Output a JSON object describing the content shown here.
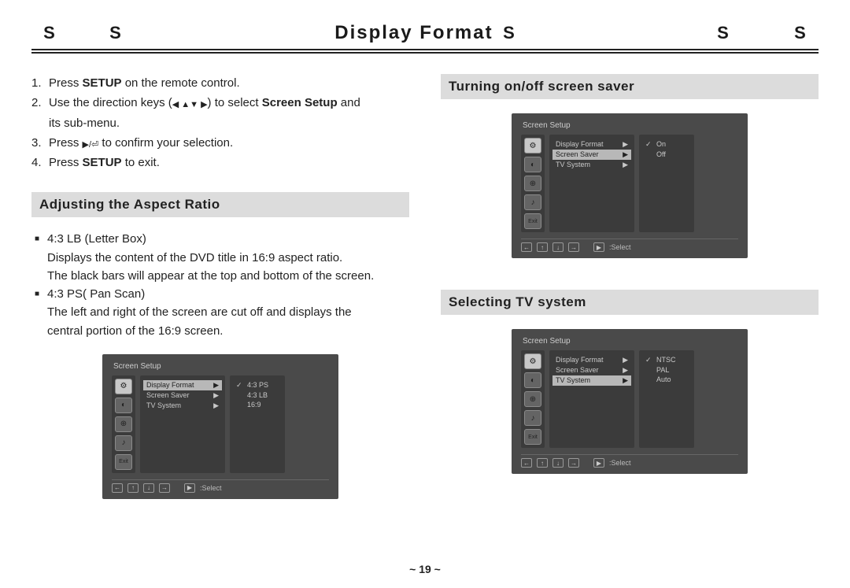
{
  "header": {
    "decor_s": "S",
    "title": "Display Format"
  },
  "intro": {
    "step1_a": "1.",
    "step1_b": "Press ",
    "step1_bold": "SETUP",
    "step1_c": " on the remote control.",
    "step2_a": "2.",
    "step2_b": "Use the direction keys (",
    "step2_keys": "◀ ▲▼ ▶",
    "step2_c": ") to select ",
    "step2_bold": "Screen Setup",
    "step2_d": "and",
    "step2_indent": "its sub-menu.",
    "step3_a": "3.",
    "step3_b": "Press ",
    "step3_keys": "▶/⏎",
    "step3_c": " to confirm your selection.",
    "step4_a": "4.",
    "step4_b": "Press ",
    "step4_bold": "SETUP",
    "step4_c": " to exit."
  },
  "sections": {
    "aspect": "Adjusting the Aspect Ratio",
    "saver": "Turning on/off screen saver",
    "tvsys": "Selecting TV system"
  },
  "aspect": {
    "b1_head": "4:3 LB (Letter Box)",
    "b1_l1": "Displays the content of the DVD title in 16:9 aspect ratio.",
    "b1_l2": "The black bars will appear at the top and bottom of the screen.",
    "b2_head": "4:3 PS( Pan Scan)",
    "b2_l1": "The left and right of the screen are cut off and displays the",
    "b2_l2": "central portion of the 16:9 screen."
  },
  "osd": {
    "title": "Screen Setup",
    "menu": {
      "display_format": "Display Format",
      "screen_saver": "Screen Saver",
      "tv_system": "TV System",
      "arrow": "▶"
    },
    "aspect_opts": {
      "o1": "4:3 PS",
      "o2": "4:3 LB",
      "o3": "16:9"
    },
    "saver_opts": {
      "o1": "On",
      "o2": "Off"
    },
    "tvsys_opts": {
      "o1": "NTSC",
      "o2": "PAL",
      "o3": "Auto"
    },
    "check": "✓",
    "footer_select": ":Select",
    "footer_play": "▶"
  },
  "page": "~ 19 ~"
}
